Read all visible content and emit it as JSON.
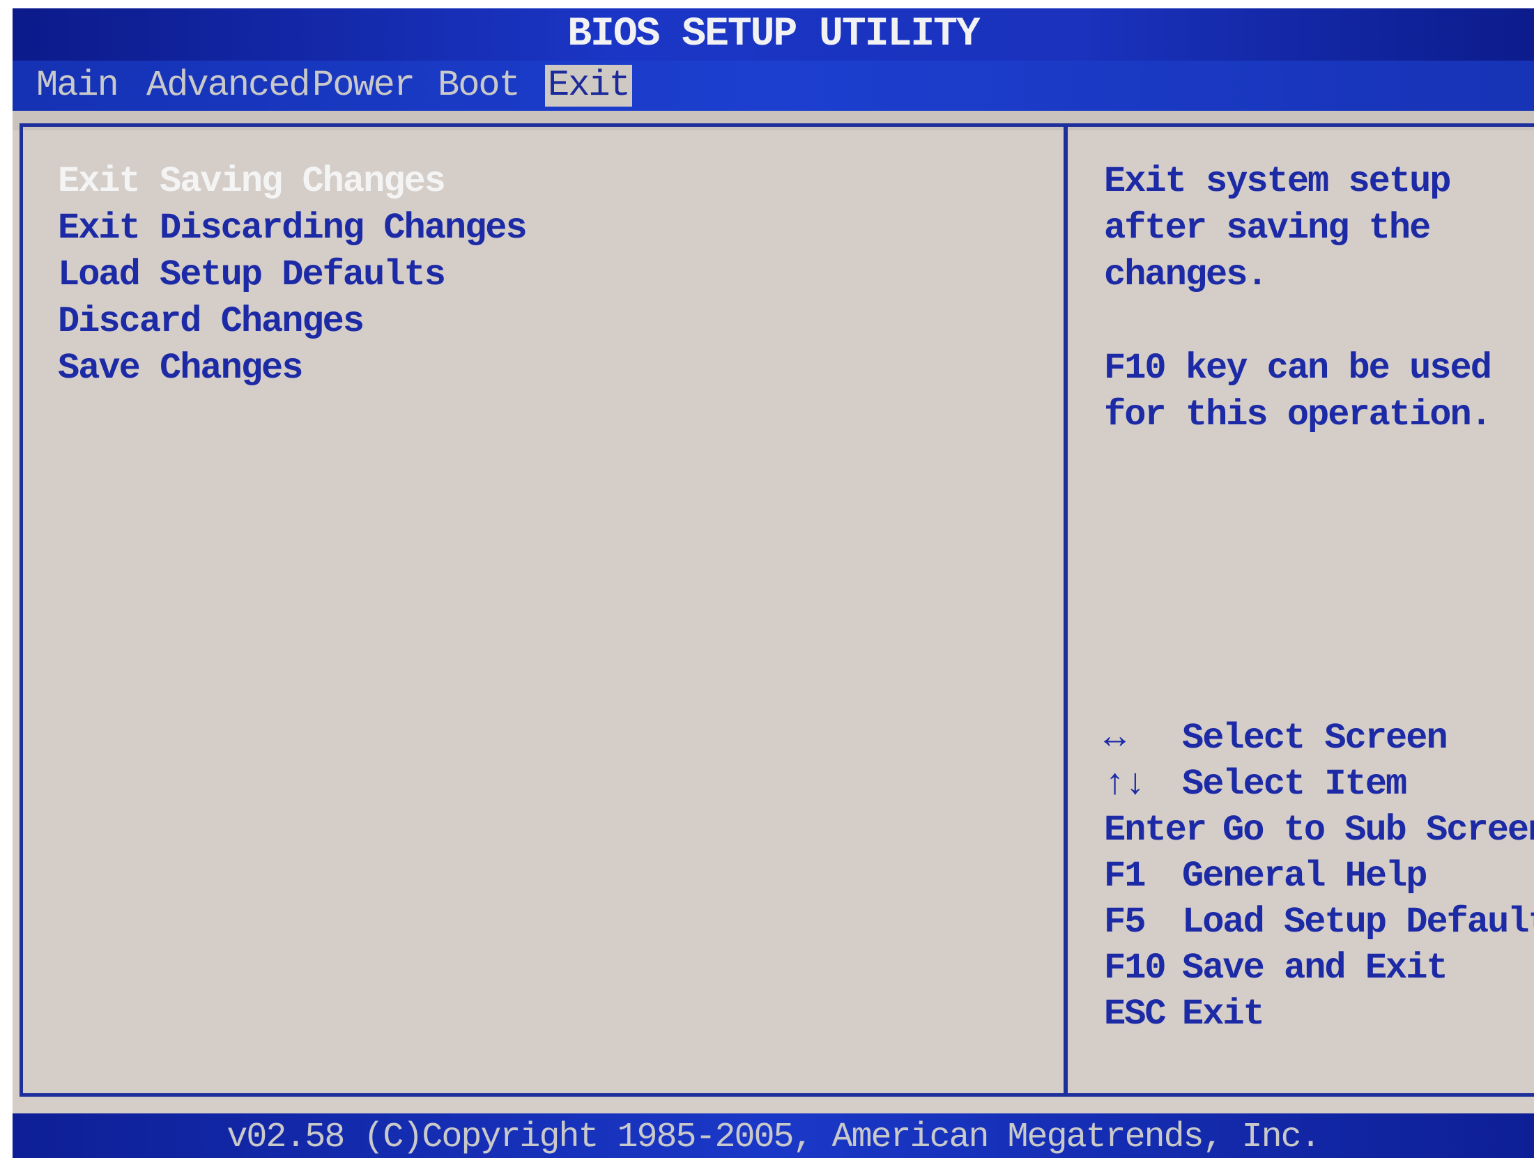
{
  "title": "BIOS SETUP UTILITY",
  "menu": {
    "items": [
      {
        "label": "Main"
      },
      {
        "label": "Advanced"
      },
      {
        "label": "Power"
      },
      {
        "label": "Boot"
      },
      {
        "label": "Exit"
      }
    ],
    "active": "Exit"
  },
  "options": [
    {
      "label": "Exit Saving Changes",
      "selected": true
    },
    {
      "label": "Exit Discarding Changes"
    },
    {
      "label": "Load Setup Defaults"
    },
    {
      "label": "Discard Changes"
    },
    {
      "label": "Save Changes"
    }
  ],
  "help": {
    "description": [
      "Exit system setup",
      "after saving the",
      "changes."
    ],
    "hint": [
      "F10 key can be used",
      "for this operation."
    ]
  },
  "keys": [
    {
      "key": "↔",
      "action": "Select Screen"
    },
    {
      "key": "↑↓",
      "action": "Select Item"
    },
    {
      "key": "Enter",
      "action": "Go to Sub Screen"
    },
    {
      "key": "F1",
      "action": "General Help"
    },
    {
      "key": "F5",
      "action": "Load Setup Defaults"
    },
    {
      "key": "F10",
      "action": "Save and Exit"
    },
    {
      "key": "ESC",
      "action": "Exit"
    }
  ],
  "footer": "v02.58 (C)Copyright 1985-2005, American Megatrends, Inc.",
  "colors": {
    "header_blue": "#1b36c6",
    "panel_gray": "#d4cdc8",
    "text_blue": "#1c2aa6",
    "highlight_white": "#f4f4f4"
  }
}
